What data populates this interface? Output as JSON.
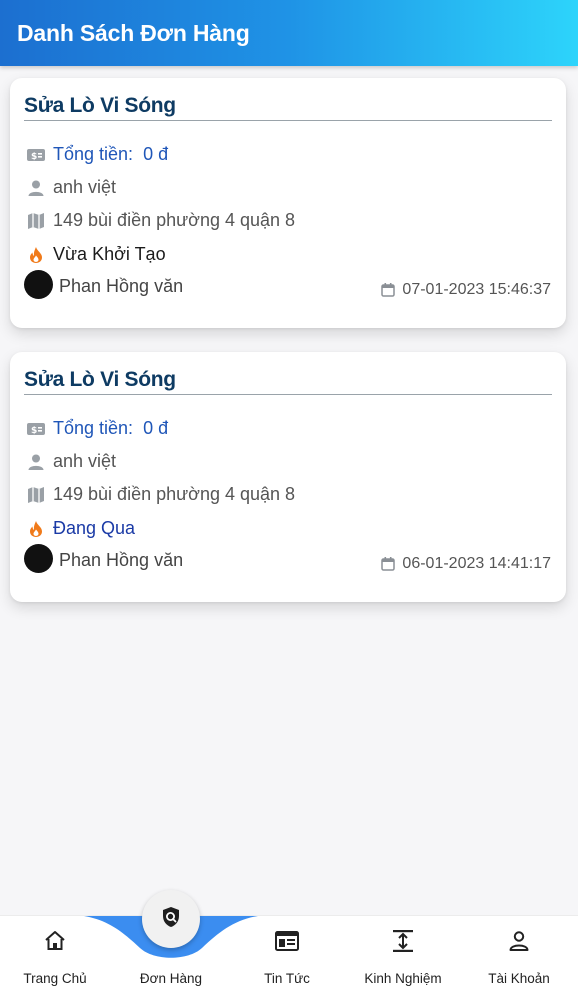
{
  "header": {
    "title": "Danh Sách Đơn Hàng"
  },
  "orders": [
    {
      "title": "Sửa Lò Vi Sóng",
      "total_label": "Tổng tiền:",
      "total_value": "0 đ",
      "customer": "anh việt",
      "address": "149 bùi điền phường 4 quận 8",
      "status": "Vừa Khởi Tạo",
      "staff": "Phan Hồng văn",
      "datetime": "07-01-2023 15:46:37"
    },
    {
      "title": "Sửa Lò Vi Sóng",
      "total_label": "Tổng tiền:",
      "total_value": "0 đ",
      "customer": "anh việt",
      "address": "149 bùi điền phường 4 quận 8",
      "status": "Đang Qua",
      "staff": "Phan Hồng văn",
      "datetime": "06-01-2023 14:41:17"
    }
  ],
  "nav": {
    "items": [
      {
        "label": "Trang Chủ",
        "icon": "home-icon"
      },
      {
        "label": "Đơn Hàng",
        "icon": "order-search-icon",
        "active": true
      },
      {
        "label": "Tin Tức",
        "icon": "news-icon"
      },
      {
        "label": "Kinh Nghiệm",
        "icon": "experience-icon"
      },
      {
        "label": "Tài Khoản",
        "icon": "account-icon"
      }
    ]
  },
  "colors": {
    "header_start": "#1c6fd0",
    "header_end": "#2dd4fb",
    "title": "#0e3b63",
    "total": "#1f56b8",
    "status_icon": "#f07a1a",
    "nav_wave": "#3b8df0"
  }
}
